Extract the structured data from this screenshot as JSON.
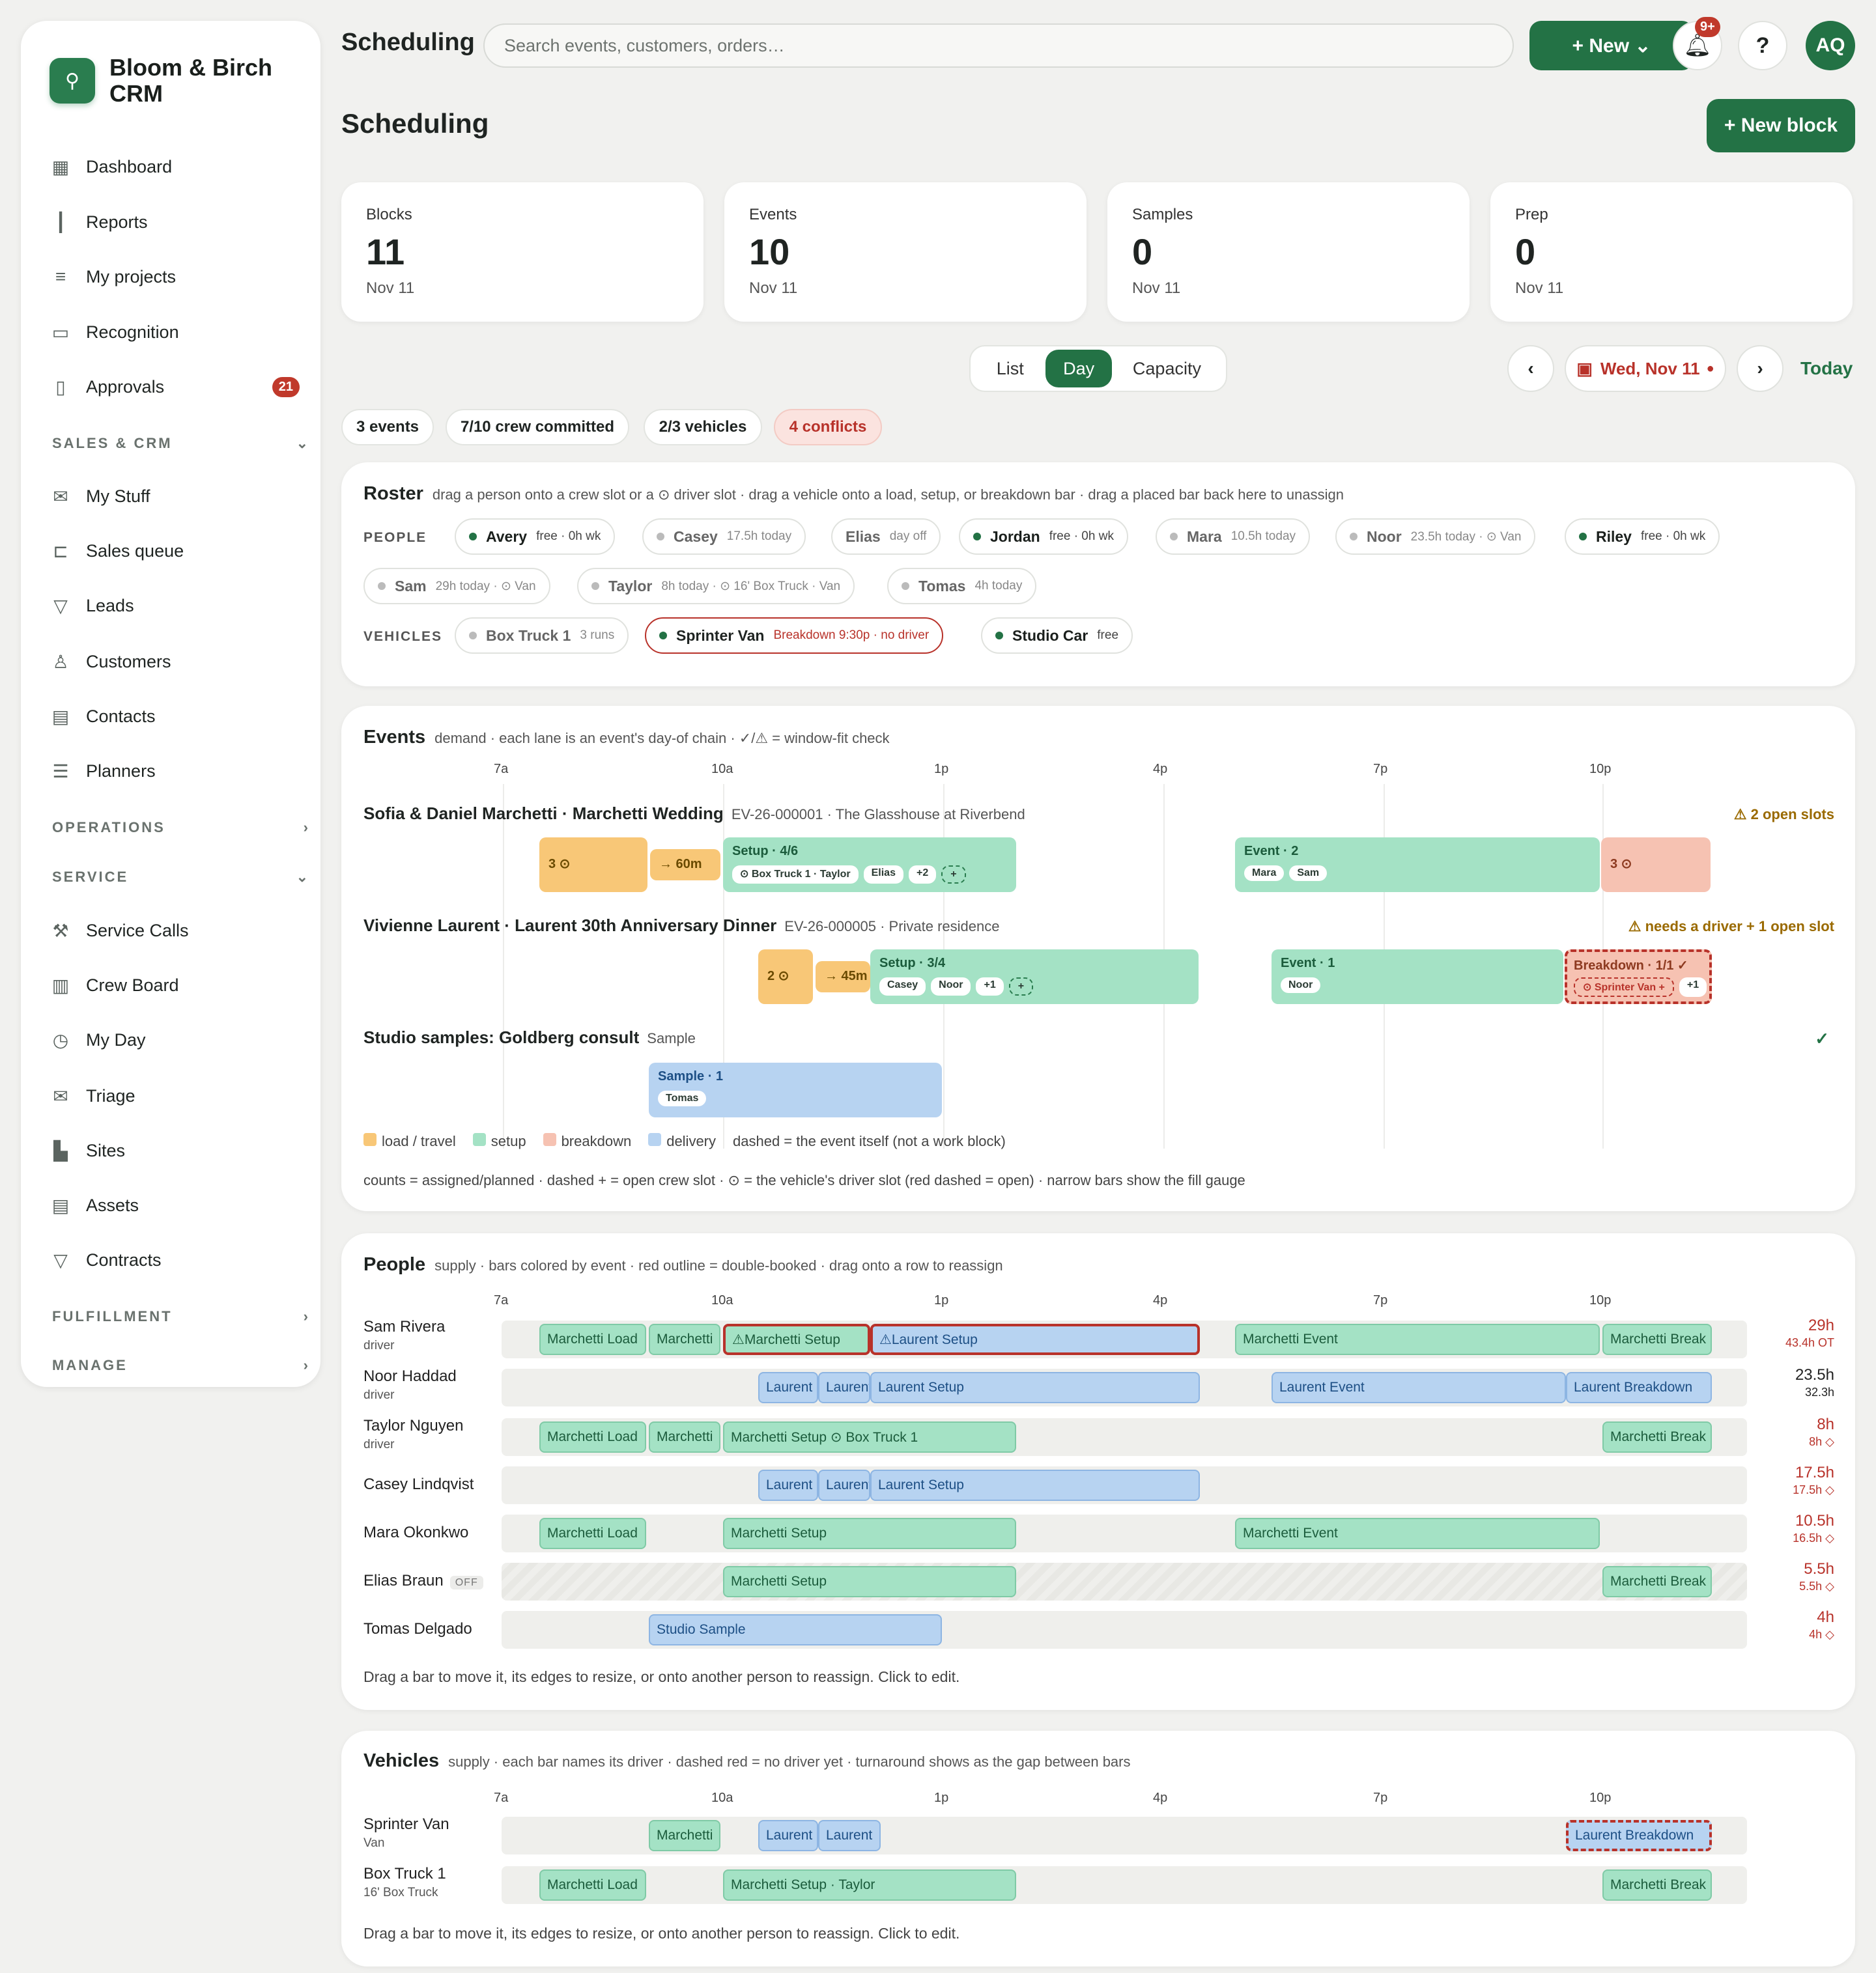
{
  "app": {
    "brand": "Bloom & Birch CRM",
    "top_title": "Scheduling",
    "search_placeholder": "Search events, customers, orders…",
    "new_label": "+  New  ⌄",
    "bell_badge": "9+",
    "avatar": "AQ"
  },
  "sidebar": {
    "items": [
      {
        "label": "Dashboard"
      },
      {
        "label": "Reports"
      },
      {
        "label": "My projects"
      },
      {
        "label": "Recognition"
      },
      {
        "label": "Approvals",
        "badge": "21"
      }
    ],
    "sections": {
      "sales": "SALES & CRM",
      "operations": "OPERATIONS",
      "service": "SERVICE",
      "fulfillment": "FULFILLMENT",
      "manage": "MANAGE"
    },
    "sales_items": [
      {
        "label": "My Stuff"
      },
      {
        "label": "Sales queue"
      },
      {
        "label": "Leads"
      },
      {
        "label": "Customers"
      },
      {
        "label": "Contacts"
      },
      {
        "label": "Planners"
      }
    ],
    "service_items": [
      {
        "label": "Service Calls"
      },
      {
        "label": "Crew Board"
      },
      {
        "label": "My Day"
      },
      {
        "label": "Triage"
      },
      {
        "label": "Sites"
      },
      {
        "label": "Assets"
      },
      {
        "label": "Contracts"
      }
    ]
  },
  "page": {
    "title": "Scheduling",
    "new_block": "+ New block"
  },
  "stats": [
    {
      "label": "Blocks",
      "value": "11",
      "sub": "Nov 11"
    },
    {
      "label": "Events",
      "value": "10",
      "sub": "Nov 11"
    },
    {
      "label": "Samples",
      "value": "0",
      "sub": "Nov 11"
    },
    {
      "label": "Prep",
      "value": "0",
      "sub": "Nov 11"
    }
  ],
  "views": {
    "list": "List",
    "day": "Day",
    "capacity": "Capacity",
    "selected": "Day"
  },
  "date": {
    "prev": "‹",
    "next": "›",
    "label": "Wed, Nov 11",
    "today": "Today"
  },
  "chips": {
    "events": "3 events",
    "crew": "7/10 crew committed",
    "vehicles": "2/3 vehicles",
    "conflicts": "4 conflicts"
  },
  "roster": {
    "title": "Roster",
    "desc": "drag a person onto a crew slot or a ⊙ driver slot · drag a vehicle onto a load, setup, or breakdown bar · drag a placed bar back here to unassign",
    "people_label": "PEOPLE",
    "vehicles_label": "VEHICLES",
    "people": [
      {
        "name": "Avery",
        "meta": "free · 0h wk"
      },
      {
        "name": "Casey",
        "meta": "17.5h today"
      },
      {
        "name": "Elias",
        "meta": "day off"
      },
      {
        "name": "Jordan",
        "meta": "free · 0h wk"
      },
      {
        "name": "Mara",
        "meta": "10.5h today"
      },
      {
        "name": "Noor",
        "meta": "23.5h today · ⊙ Van"
      },
      {
        "name": "Riley",
        "meta": "free · 0h wk"
      },
      {
        "name": "Sam",
        "meta": "29h today · ⊙ Van"
      },
      {
        "name": "Taylor",
        "meta": "8h today · ⊙ 16' Box Truck · Van"
      },
      {
        "name": "Tomas",
        "meta": "4h today"
      }
    ],
    "vehicles": [
      {
        "name": "Box Truck 1",
        "meta": "3 runs"
      },
      {
        "name": "Sprinter Van",
        "meta": "Breakdown 9:30p · no driver"
      },
      {
        "name": "Studio Car",
        "meta": "free"
      }
    ]
  },
  "events_card": {
    "title": "Events",
    "desc": "demand · each lane is an event's day-of chain · ✓/⚠ = window-fit check",
    "axis": [
      "7a",
      "10a",
      "1p",
      "4p",
      "7p",
      "10p"
    ],
    "lanes": [
      {
        "title": "Sofia & Daniel Marchetti · Marchetti Wedding",
        "code": "EV-26-000001 · The Glasshouse at Riverbend",
        "warn": "⚠ 2 open slots",
        "blocks": {
          "load": "3  ⊙",
          "travel": "→ 60m",
          "setup": "Setup · 4/6",
          "setup_tags": [
            "⊙ Box Truck 1 · Taylor",
            "Elias",
            "+2",
            "+"
          ],
          "event": "Event · 2",
          "event_tags": [
            "Mara",
            "Sam"
          ],
          "break": "3  ⊙"
        }
      },
      {
        "title": "Vivienne Laurent · Laurent 30th Anniversary Dinner",
        "code": "EV-26-000005 · Private residence",
        "warn": "⚠ needs a driver + 1 open slot",
        "blocks": {
          "load": "2  ⊙",
          "travel": "→ 45m",
          "setup": "Setup · 3/4",
          "setup_tags": [
            "Casey",
            "Noor",
            "+1",
            "+"
          ],
          "event": "Event · 1",
          "event_tags": [
            "Noor"
          ],
          "break": "Breakdown · 1/1 ✓",
          "break_tags": [
            "⊙ Sprinter Van +",
            "+1"
          ]
        }
      },
      {
        "title": "Studio samples: Goldberg consult",
        "code": "Sample",
        "ok": "✓",
        "blocks": {
          "sample": "Sample · 1",
          "sample_tags": [
            "Tomas"
          ]
        }
      }
    ],
    "legend": {
      "load": "load / travel",
      "setup": "setup",
      "break": "breakdown",
      "deliv": "delivery",
      "dashed": "dashed = the event itself (not a work block)"
    },
    "foot": "counts = assigned/planned · dashed + = open crew slot · ⊙ = the vehicle's driver slot (red dashed = open) · narrow bars show the fill gauge"
  },
  "people_card": {
    "title": "People",
    "desc": "supply · bars colored by event · red outline = double-booked · drag onto a row to reassign",
    "axis": [
      "7a",
      "10a",
      "1p",
      "4p",
      "7p",
      "10p"
    ],
    "rows": [
      {
        "name": "Sam Rivera",
        "sub": "driver",
        "h1": "29h",
        "h2": "43.4h OT",
        "bars": [
          "Marchetti Load",
          "Marchetti",
          "⚠Marchetti Setup",
          "⚠Laurent Setup",
          "Marchetti Event",
          "Marchetti Break"
        ]
      },
      {
        "name": "Noor Haddad",
        "sub": "driver",
        "h1": "23.5h",
        "h2": "32.3h",
        "bars": [
          "Laurent",
          "Laurent",
          "Laurent Setup",
          "Laurent Event",
          "Laurent Breakdown"
        ]
      },
      {
        "name": "Taylor Nguyen",
        "sub": "driver",
        "h1": "8h",
        "h2": "8h ◇",
        "bars": [
          "Marchetti Load",
          "Marchetti",
          "Marchetti Setup  ⊙ Box Truck 1",
          "Marchetti Break"
        ]
      },
      {
        "name": "Casey Lindqvist",
        "sub": "",
        "h1": "17.5h",
        "h2": "17.5h ◇",
        "bars": [
          "Laurent",
          "Laurent",
          "Laurent Setup"
        ]
      },
      {
        "name": "Mara Okonkwo",
        "sub": "",
        "h1": "10.5h",
        "h2": "16.5h ◇",
        "bars": [
          "Marchetti Load",
          "Marchetti Setup",
          "Marchetti Event"
        ]
      },
      {
        "name": "Elias Braun",
        "off": "OFF",
        "sub": "",
        "h1": "5.5h",
        "h2": "5.5h ◇",
        "bars": [
          "Marchetti Setup",
          "Marchetti Break"
        ]
      },
      {
        "name": "Tomas Delgado",
        "sub": "",
        "h1": "4h",
        "h2": "4h ◇",
        "bars": [
          "Studio Sample"
        ]
      }
    ],
    "foot": "Drag a bar to move it, its edges to resize, or onto another person to reassign. Click to edit."
  },
  "vehicles_card": {
    "title": "Vehicles",
    "desc": "supply · each bar names its driver · dashed red = no driver yet · turnaround shows as the gap between bars",
    "axis": [
      "7a",
      "10a",
      "1p",
      "4p",
      "7p",
      "10p"
    ],
    "rows": [
      {
        "name": "Sprinter Van",
        "sub": "Van",
        "bars": [
          "Marchetti",
          "Laurent",
          "Laurent",
          "Laurent Breakdown"
        ]
      },
      {
        "name": "Box Truck 1",
        "sub": "16' Box Truck",
        "bars": [
          "Marchetti Load",
          "Marchetti Setup  · Taylor",
          "Marchetti Break"
        ]
      }
    ],
    "foot": "Drag a bar to move it, its edges to resize, or onto another person to reassign. Click to edit."
  }
}
